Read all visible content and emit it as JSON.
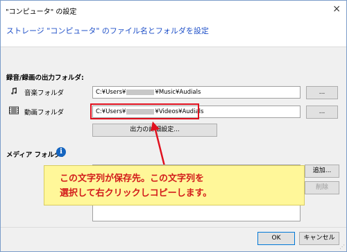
{
  "window": {
    "title": "\"コンピュータ\" の設定",
    "close_glyph": "×"
  },
  "header": {
    "subtitle": "ストレージ \"コンピュータ\" のファイル名とフォルダを設定"
  },
  "output_folders": {
    "section_label": "録音/録画の出力フォルダ:",
    "music": {
      "icon": "music-note-icon",
      "label": "音楽フォルダ",
      "path_prefix": "C:¥Users¥",
      "path_suffix": "¥Music¥Audials",
      "browse_label": "..."
    },
    "video": {
      "icon": "film-icon",
      "label": "動画フォルダ",
      "path_prefix": "C:¥Users¥",
      "path_suffix": "¥Videos¥Audials",
      "browse_label": "...",
      "highlight_color": "#e0101e"
    },
    "advanced_button_label": "出力の詳細設定..."
  },
  "media_folders": {
    "section_label": "メディア フォルダ:",
    "info_icon": "i",
    "add_button_label": "追加...",
    "remove_button_label": "削除"
  },
  "callout": {
    "line1": "この文字列が保存先。この文字列を",
    "line2": "選択して右クリックしコピーします。",
    "background": "#fff799",
    "text_color": "#d21a1a"
  },
  "footer": {
    "ok_label": "OK",
    "cancel_label": "キャンセル"
  }
}
